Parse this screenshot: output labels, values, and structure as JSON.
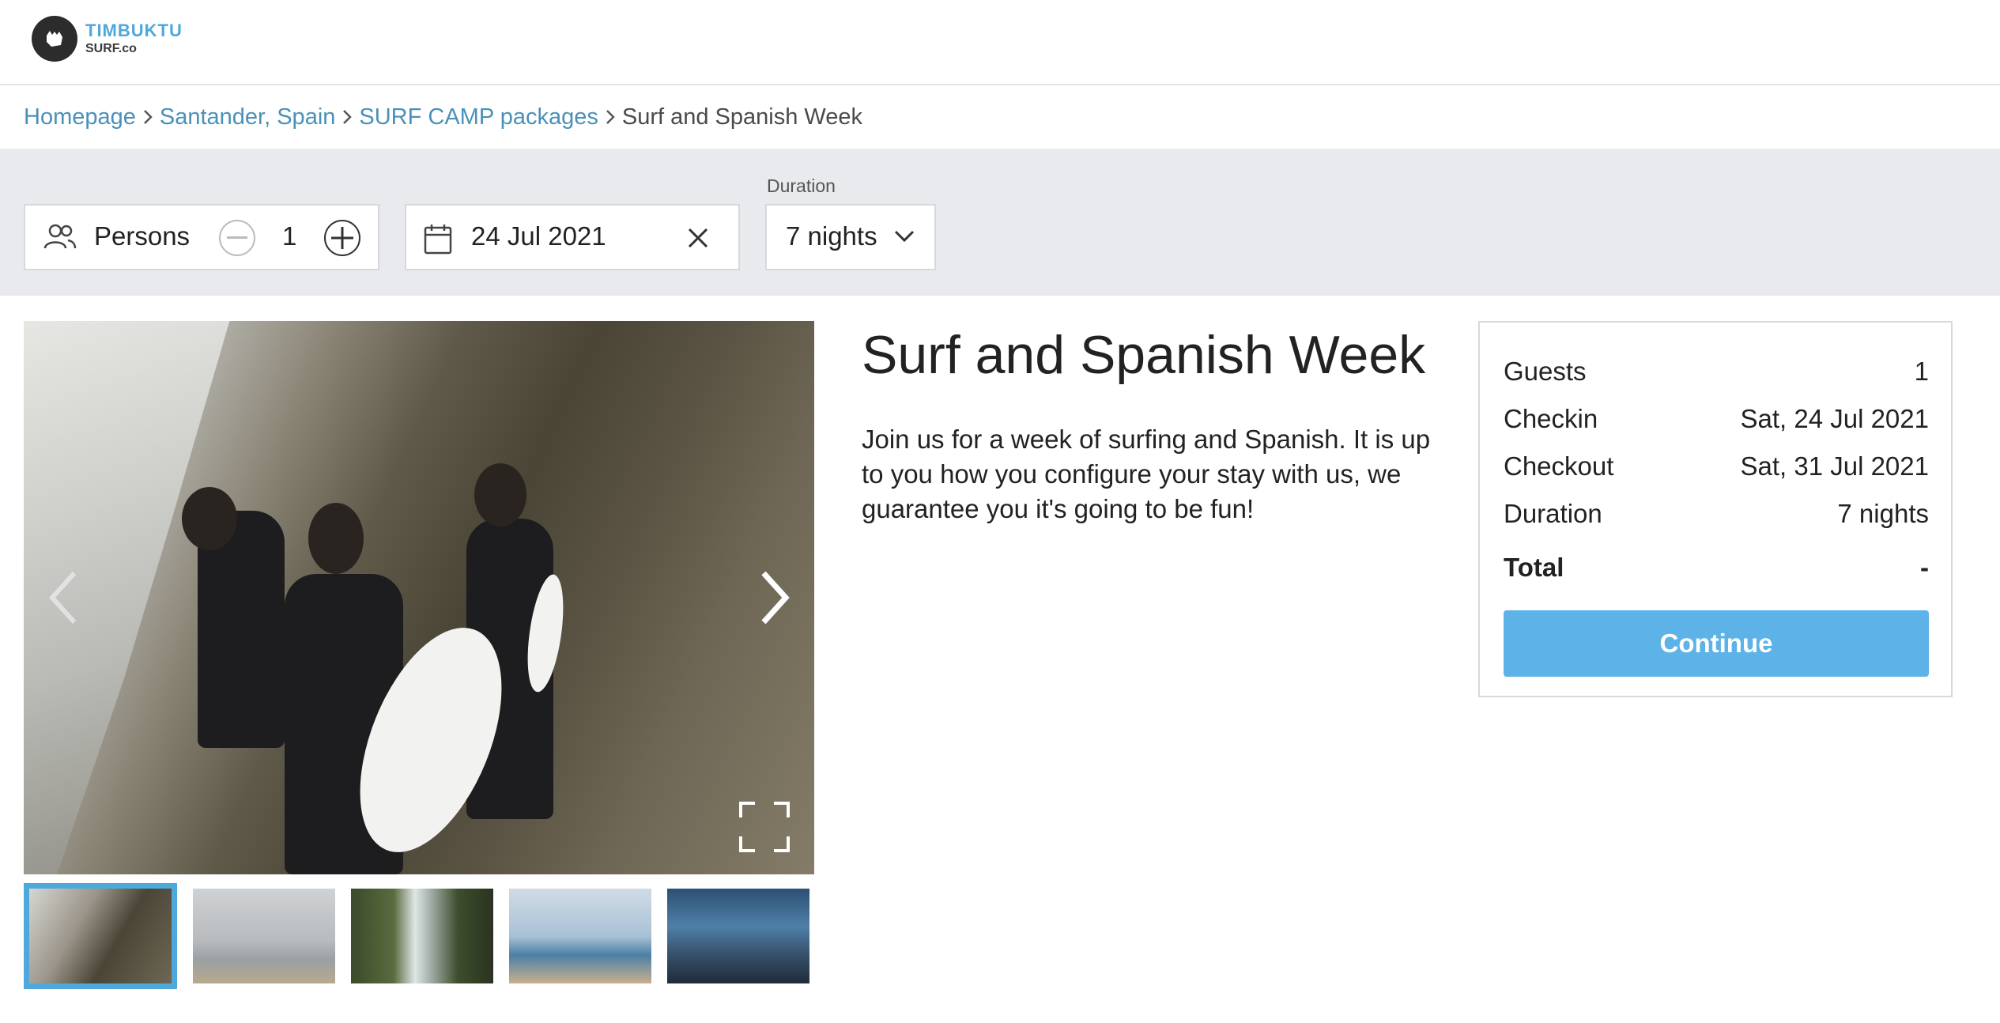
{
  "brand": {
    "line1": "TIMBUKTU",
    "line2": "SURF.co",
    "accent_color": "#4ea8d9"
  },
  "breadcrumb": [
    {
      "label": "Homepage"
    },
    {
      "label": "Santander, Spain"
    },
    {
      "label": "SURF CAMP packages"
    },
    {
      "label": "Surf and Spanish Week"
    }
  ],
  "filters": {
    "persons": {
      "label": "Persons",
      "count": "1",
      "icon": "users-icon"
    },
    "date": {
      "value": "24 Jul 2021",
      "icon": "calendar-icon"
    },
    "duration": {
      "label": "Duration",
      "value": "7 nights"
    }
  },
  "gallery": {
    "thumbnail_count": 5,
    "active_index": 0
  },
  "product": {
    "title": "Surf and Spanish Week",
    "description": "Join us for a week of surfing and Spanish. It is up to you how you configure your stay with us, we guarantee you it's going to be fun!"
  },
  "summary": {
    "rows": [
      {
        "label": "Guests",
        "value": "1"
      },
      {
        "label": "Checkin",
        "value": "Sat, 24 Jul 2021"
      },
      {
        "label": "Checkout",
        "value": "Sat, 31 Jul 2021"
      },
      {
        "label": "Duration",
        "value": "7 nights"
      }
    ],
    "total": {
      "label": "Total",
      "value": "-"
    },
    "continue_label": "Continue",
    "button_color": "#5db3e8"
  }
}
